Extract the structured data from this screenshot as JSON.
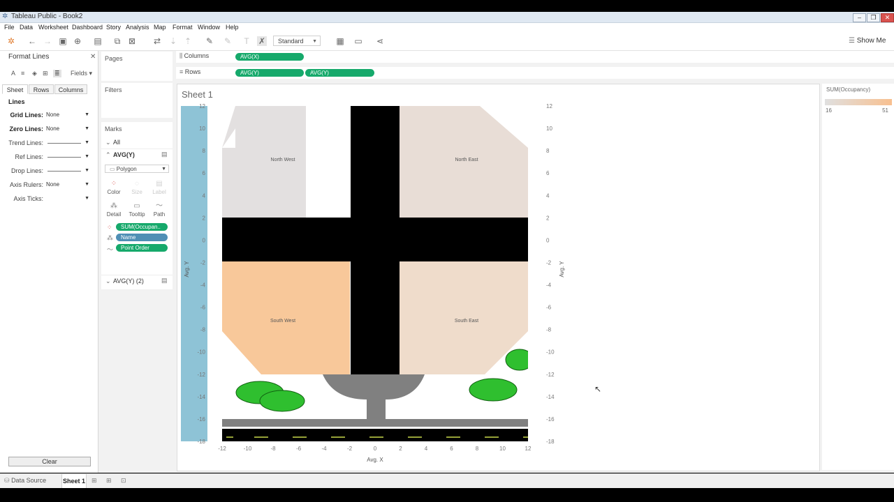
{
  "window": {
    "title": "Tableau Public - Book2"
  },
  "menu": [
    "File",
    "Data",
    "Worksheet",
    "Dashboard",
    "Story",
    "Analysis",
    "Map",
    "Format",
    "Window",
    "Help"
  ],
  "toolbar": {
    "fit_mode": "Standard",
    "show_me": "Show Me"
  },
  "format_pane": {
    "title": "Format Lines",
    "fields_label": "Fields",
    "tabs": [
      "Sheet",
      "Rows",
      "Columns"
    ],
    "section": "Lines",
    "settings": [
      {
        "label": "Grid Lines:",
        "value": "None"
      },
      {
        "label": "Zero Lines:",
        "value": "None"
      },
      {
        "label": "Trend Lines:",
        "value": ""
      },
      {
        "label": "Ref Lines:",
        "value": ""
      },
      {
        "label": "Drop Lines:",
        "value": ""
      },
      {
        "label": "Axis Rulers:",
        "value": "None"
      },
      {
        "label": "Axis Ticks:",
        "value": ""
      }
    ],
    "clear_label": "Clear"
  },
  "cards": {
    "pages": "Pages",
    "filters": "Filters",
    "marks": {
      "title": "Marks",
      "all_label": "All",
      "primary_label": "AVG(Y)",
      "mark_type": "Polygon",
      "buttons": [
        "Color",
        "Size",
        "Label",
        "Detail",
        "Tooltip",
        "Path"
      ],
      "fields": [
        "SUM(Occupan..",
        "Name",
        "Point Order"
      ],
      "secondary_label": "AVG(Y) (2)"
    }
  },
  "shelves": {
    "columns_label": "Columns",
    "columns_pills": [
      "AVG(X)"
    ],
    "rows_label": "Rows",
    "rows_pills": [
      "AVG(Y)",
      "AVG(Y)"
    ]
  },
  "sheet": {
    "title": "Sheet 1"
  },
  "chart_data": {
    "type": "polygon-map",
    "xlabel": "Avg. X",
    "ylabel_left": "Avg. Y",
    "ylabel_right": "Avg. Y",
    "xlim": [
      -12,
      12
    ],
    "ylim": [
      -18,
      12
    ],
    "x_ticks": [
      "-12",
      "-10",
      "-8",
      "-6",
      "-4",
      "-2",
      "0",
      "2",
      "4",
      "6",
      "8",
      "10",
      "12"
    ],
    "y_ticks": [
      "12",
      "10",
      "8",
      "6",
      "4",
      "2",
      "0",
      "-2",
      "-4",
      "-6",
      "-8",
      "-10",
      "-12",
      "-14",
      "-16",
      "-18"
    ],
    "regions": [
      {
        "name": "North West",
        "color": "#e3e0e0"
      },
      {
        "name": "North East",
        "color": "#e8ddd6"
      },
      {
        "name": "South West",
        "color": "#f8c89a"
      },
      {
        "name": "South East",
        "color": "#efdccb"
      }
    ],
    "color_legend": {
      "field": "SUM(Occupancy)",
      "min": "16",
      "max": "51",
      "low_color": "#e0e0e0",
      "high_color": "#f8c090"
    }
  },
  "bottom": {
    "data_source": "Data Source",
    "sheet_tab": "Sheet 1"
  }
}
